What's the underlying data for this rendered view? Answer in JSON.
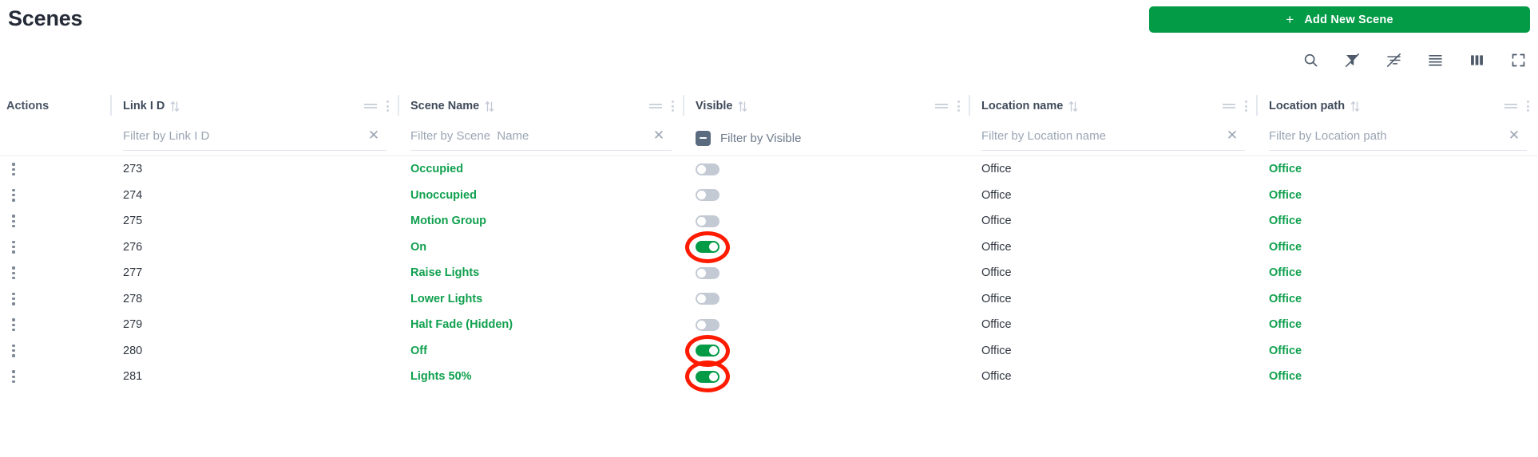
{
  "header": {
    "title": "Scenes",
    "add_button": {
      "label": "Add New Scene",
      "plus": "+"
    },
    "accent_green": "#049b47",
    "link_green": "#10a04e",
    "annotation_red": "#fe1b00"
  },
  "toolbar": {
    "icons": [
      {
        "name": "search-icon",
        "title": "Search"
      },
      {
        "name": "filter-off-icon",
        "title": "Hide Filters"
      },
      {
        "name": "filter-list-off-icon",
        "title": "Toggle Filters"
      },
      {
        "name": "density-icon",
        "title": "Toggle Density"
      },
      {
        "name": "columns-icon",
        "title": "Show/Hide Columns"
      },
      {
        "name": "fullscreen-icon",
        "title": "Toggle Full Screen"
      }
    ]
  },
  "table": {
    "actions_label": "Actions",
    "columns": [
      {
        "key": "link_id",
        "label": "Link I D",
        "filter_placeholder": "Filter by Link I D",
        "sortable": true,
        "filter_type": "text"
      },
      {
        "key": "scene_name",
        "label": "Scene Name",
        "filter_placeholder": "Filter by Scene  Name",
        "sortable": true,
        "filter_type": "text"
      },
      {
        "key": "visible",
        "label": "Visible",
        "filter_placeholder": "Filter by Visible",
        "sortable": true,
        "filter_type": "checkbox",
        "checkbox_state": "indeterminate"
      },
      {
        "key": "location_name",
        "label": "Location name",
        "filter_placeholder": "Filter by Location name",
        "sortable": true,
        "filter_type": "text"
      },
      {
        "key": "location_path",
        "label": "Location path",
        "filter_placeholder": "Filter by Location path",
        "sortable": true,
        "filter_type": "text"
      }
    ],
    "rows": [
      {
        "link_id": "273",
        "scene_name": "Occupied",
        "visible": false,
        "location_name": "Office",
        "location_path": "Office",
        "annotated": false
      },
      {
        "link_id": "274",
        "scene_name": "Unoccupied",
        "visible": false,
        "location_name": "Office",
        "location_path": "Office",
        "annotated": false
      },
      {
        "link_id": "275",
        "scene_name": "Motion Group",
        "visible": false,
        "location_name": "Office",
        "location_path": "Office",
        "annotated": false
      },
      {
        "link_id": "276",
        "scene_name": "On",
        "visible": true,
        "location_name": "Office",
        "location_path": "Office",
        "annotated": true
      },
      {
        "link_id": "277",
        "scene_name": "Raise Lights",
        "visible": false,
        "location_name": "Office",
        "location_path": "Office",
        "annotated": false
      },
      {
        "link_id": "278",
        "scene_name": "Lower Lights",
        "visible": false,
        "location_name": "Office",
        "location_path": "Office",
        "annotated": false
      },
      {
        "link_id": "279",
        "scene_name": "Halt Fade (Hidden)",
        "visible": false,
        "location_name": "Office",
        "location_path": "Office",
        "annotated": false
      },
      {
        "link_id": "280",
        "scene_name": "Off",
        "visible": true,
        "location_name": "Office",
        "location_path": "Office",
        "annotated": true
      },
      {
        "link_id": "281",
        "scene_name": "Lights 50%",
        "visible": true,
        "location_name": "Office",
        "location_path": "Office",
        "annotated": true
      }
    ]
  }
}
